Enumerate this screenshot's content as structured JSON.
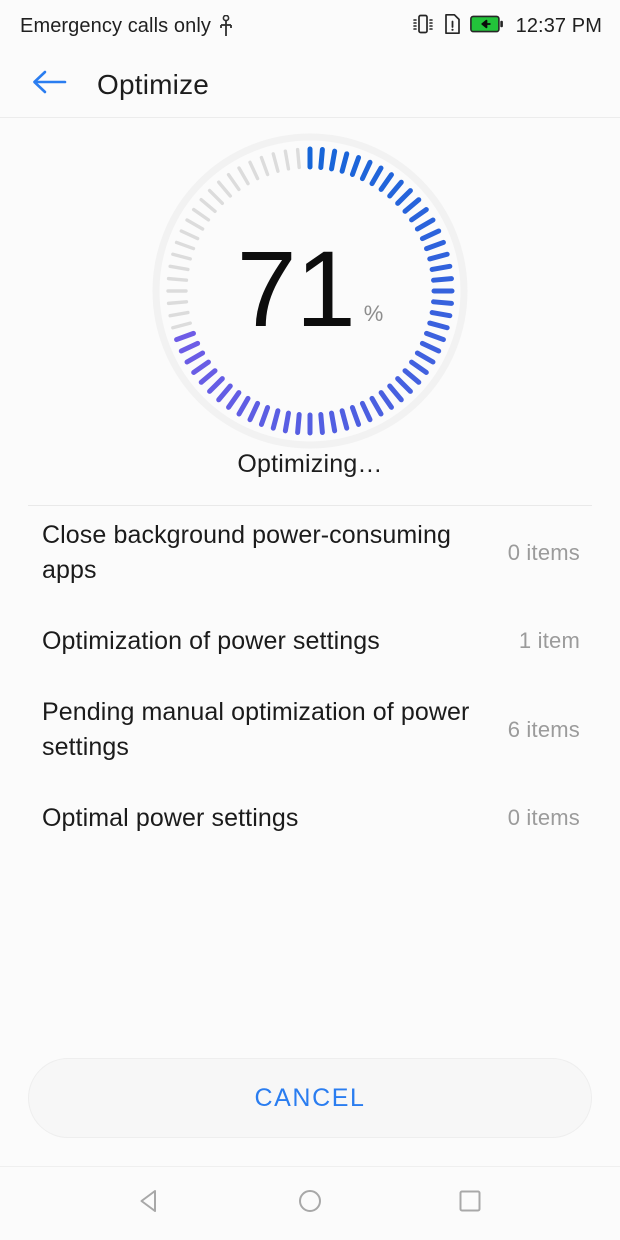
{
  "status_bar": {
    "carrier": "Emergency calls only",
    "usb_icon": "usb-icon",
    "vibrate_icon": "vibrate-icon",
    "sim_alert_icon": "sim-card-alert-icon",
    "battery_icon": "battery-charging-icon",
    "battery_color": "#22c33a",
    "time": "12:37 PM"
  },
  "app_bar": {
    "back_icon": "back-arrow-icon",
    "back_color": "#2a7df0",
    "title": "Optimize"
  },
  "dial": {
    "value": "71",
    "unit": "%",
    "status": "Optimizing…",
    "percent": 71,
    "total_ticks": 72,
    "color_start": "#1565d8",
    "color_end": "#6e5ce6",
    "track_color": "#dcdcdc",
    "ring_color": "#f1f1f1"
  },
  "list": {
    "items": [
      {
        "label": "Close background power-consuming apps",
        "count": "0 items"
      },
      {
        "label": "Optimization of power settings",
        "count": "1 item"
      },
      {
        "label": "Pending manual optimization of power settings",
        "count": "6 items"
      },
      {
        "label": "Optimal power settings",
        "count": "0 items"
      }
    ]
  },
  "footer": {
    "cancel_label": "CANCEL",
    "cancel_color": "#2a7df0"
  },
  "nav_bar": {
    "back_icon": "nav-back-triangle-icon",
    "home_icon": "nav-home-circle-icon",
    "recents_icon": "nav-recents-square-icon",
    "icon_color": "#a8a8a8"
  }
}
